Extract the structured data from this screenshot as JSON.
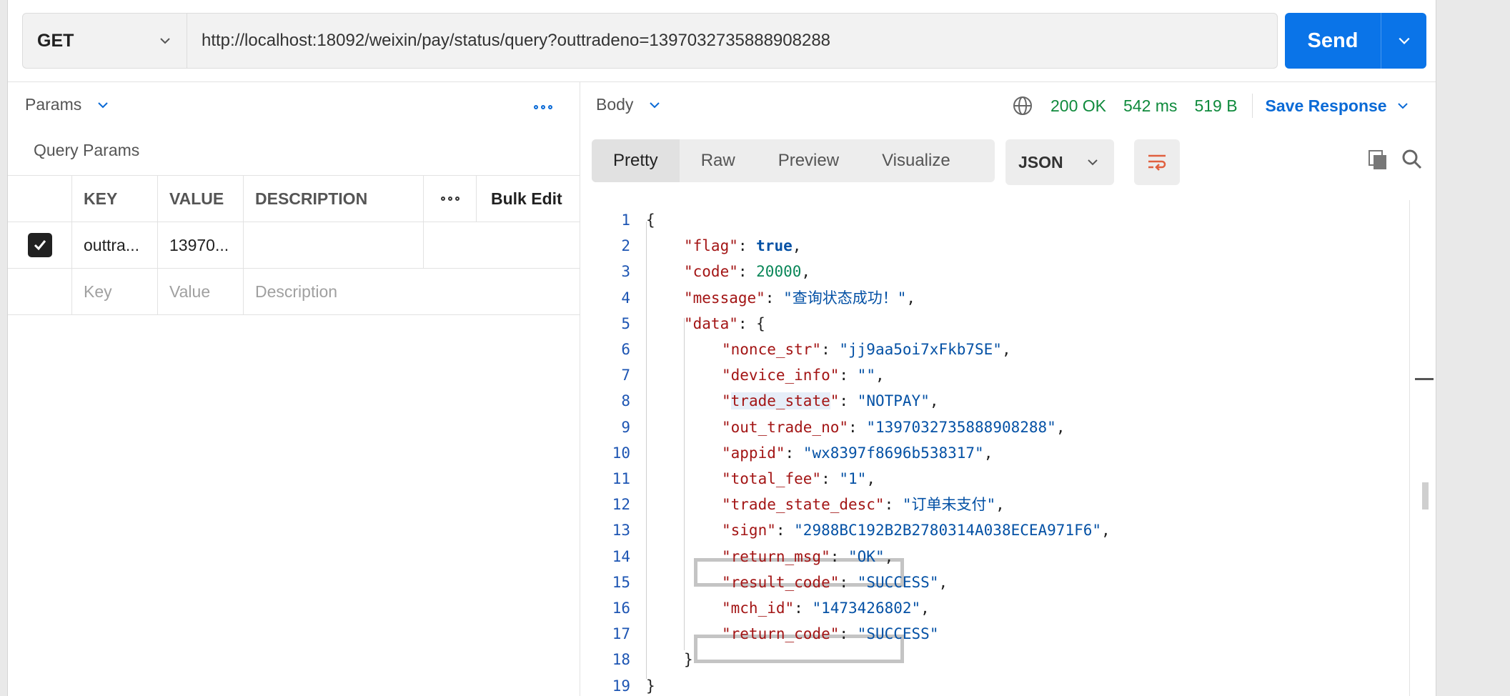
{
  "request": {
    "method": "GET",
    "url": "http://localhost:18092/weixin/pay/status/query?outtradeno=1397032735888908288",
    "send_label": "Send"
  },
  "left": {
    "tab_label": "Params",
    "section_title": "Query Params",
    "columns": {
      "key": "KEY",
      "value": "VALUE",
      "description": "DESCRIPTION",
      "bulk_edit": "Bulk Edit"
    },
    "row": {
      "key": "outtra...",
      "value": "13970..."
    },
    "placeholders": {
      "key": "Key",
      "value": "Value",
      "description": "Description"
    }
  },
  "response": {
    "body_label": "Body",
    "status": "200 OK",
    "time": "542 ms",
    "size": "519 B",
    "save_label": "Save Response",
    "status_color": "#0f8a3c",
    "tabs": [
      "Pretty",
      "Raw",
      "Preview",
      "Visualize"
    ],
    "active_tab": "Pretty",
    "format": "JSON"
  },
  "code_lines": [
    {
      "n": "1",
      "indent": 0,
      "parts": [
        [
          "p",
          "{"
        ]
      ]
    },
    {
      "n": "2",
      "indent": 1,
      "parts": [
        [
          "k",
          "\"flag\""
        ],
        [
          "p",
          ": "
        ],
        [
          "b",
          "true"
        ],
        [
          "p",
          ","
        ]
      ]
    },
    {
      "n": "3",
      "indent": 1,
      "parts": [
        [
          "k",
          "\"code\""
        ],
        [
          "p",
          ": "
        ],
        [
          "n",
          "20000"
        ],
        [
          "p",
          ","
        ]
      ]
    },
    {
      "n": "4",
      "indent": 1,
      "parts": [
        [
          "k",
          "\"message\""
        ],
        [
          "p",
          ": "
        ],
        [
          "s",
          "\"查询状态成功！\""
        ],
        [
          "p",
          ","
        ]
      ]
    },
    {
      "n": "5",
      "indent": 1,
      "parts": [
        [
          "k",
          "\"data\""
        ],
        [
          "p",
          ": {"
        ]
      ]
    },
    {
      "n": "6",
      "indent": 2,
      "parts": [
        [
          "k",
          "\"nonce_str\""
        ],
        [
          "p",
          ": "
        ],
        [
          "s",
          "\"jj9aa5oi7xFkb7SE\""
        ],
        [
          "p",
          ","
        ]
      ]
    },
    {
      "n": "7",
      "indent": 2,
      "parts": [
        [
          "k",
          "\"device_info\""
        ],
        [
          "p",
          ": "
        ],
        [
          "s",
          "\"\""
        ],
        [
          "p",
          ","
        ]
      ]
    },
    {
      "n": "8",
      "indent": 2,
      "parts": [
        [
          "k",
          "\""
        ],
        [
          "k selbg",
          "trade_state"
        ],
        [
          "k",
          "\""
        ],
        [
          "p",
          ": "
        ],
        [
          "s",
          "\"NOTPAY\""
        ],
        [
          "p",
          ","
        ]
      ]
    },
    {
      "n": "9",
      "indent": 2,
      "parts": [
        [
          "k",
          "\"out_trade_no\""
        ],
        [
          "p",
          ": "
        ],
        [
          "s",
          "\"1397032735888908288\""
        ],
        [
          "p",
          ","
        ]
      ]
    },
    {
      "n": "10",
      "indent": 2,
      "parts": [
        [
          "k",
          "\"appid\""
        ],
        [
          "p",
          ": "
        ],
        [
          "s",
          "\"wx8397f8696b538317\""
        ],
        [
          "p",
          ","
        ]
      ]
    },
    {
      "n": "11",
      "indent": 2,
      "parts": [
        [
          "k",
          "\"total_fee\""
        ],
        [
          "p",
          ": "
        ],
        [
          "s",
          "\"1\""
        ],
        [
          "p",
          ","
        ]
      ]
    },
    {
      "n": "12",
      "indent": 2,
      "parts": [
        [
          "k",
          "\"trade_state_desc\""
        ],
        [
          "p",
          ": "
        ],
        [
          "s",
          "\"订单未支付\""
        ],
        [
          "p",
          ","
        ]
      ]
    },
    {
      "n": "13",
      "indent": 2,
      "parts": [
        [
          "k",
          "\"sign\""
        ],
        [
          "p",
          ": "
        ],
        [
          "s",
          "\"2988BC192B2B2780314A038ECEA971F6\""
        ],
        [
          "p",
          ","
        ]
      ]
    },
    {
      "n": "14",
      "indent": 2,
      "parts": [
        [
          "k",
          "\"return_msg\""
        ],
        [
          "p",
          ": "
        ],
        [
          "s",
          "\"OK\""
        ],
        [
          "p",
          ","
        ]
      ]
    },
    {
      "n": "15",
      "indent": 2,
      "parts": [
        [
          "k",
          "\"result_code\""
        ],
        [
          "p",
          ": "
        ],
        [
          "s",
          "\"SUCCESS\""
        ],
        [
          "p",
          ","
        ]
      ]
    },
    {
      "n": "16",
      "indent": 2,
      "parts": [
        [
          "k",
          "\"mch_id\""
        ],
        [
          "p",
          ": "
        ],
        [
          "s",
          "\"1473426802\""
        ],
        [
          "p",
          ","
        ]
      ]
    },
    {
      "n": "17",
      "indent": 2,
      "parts": [
        [
          "k",
          "\"return_code\""
        ],
        [
          "p",
          ": "
        ],
        [
          "s",
          "\"SUCCESS\""
        ]
      ]
    },
    {
      "n": "18",
      "indent": 1,
      "parts": [
        [
          "p",
          "}"
        ]
      ]
    },
    {
      "n": "19",
      "indent": 0,
      "parts": [
        [
          "p",
          "}"
        ]
      ]
    }
  ]
}
